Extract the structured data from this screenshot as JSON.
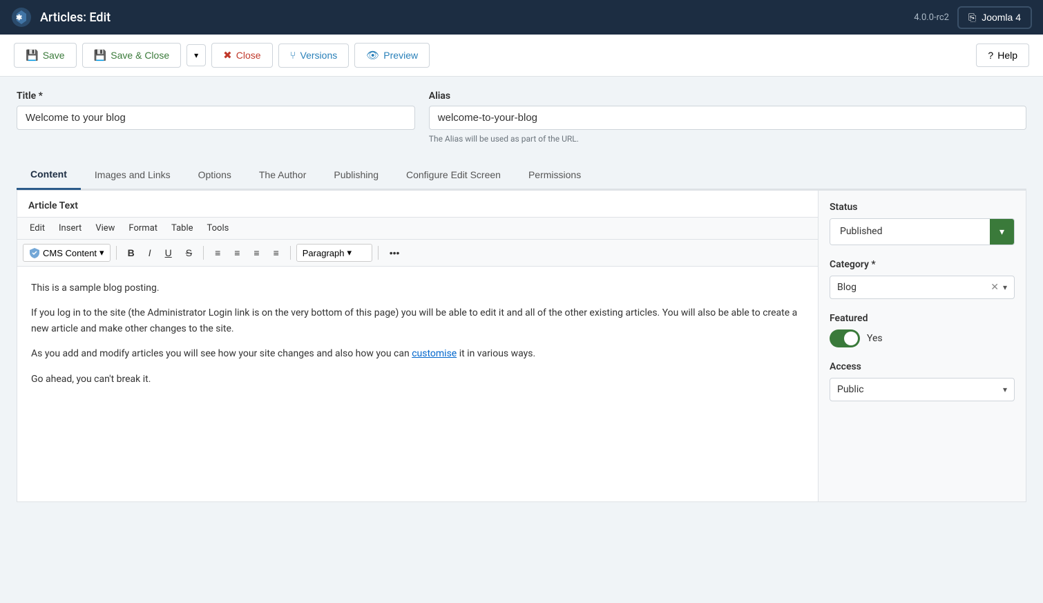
{
  "topnav": {
    "title": "Articles: Edit",
    "version": "4.0.0-rc2",
    "joomla_btn": "Joomla 4"
  },
  "toolbar": {
    "save_label": "Save",
    "save_close_label": "Save & Close",
    "close_label": "Close",
    "versions_label": "Versions",
    "preview_label": "Preview",
    "help_label": "Help"
  },
  "form": {
    "title_label": "Title *",
    "title_value": "Welcome to your blog",
    "alias_label": "Alias",
    "alias_value": "welcome-to-your-blog",
    "alias_hint": "The Alias will be used as part of the URL."
  },
  "tabs": [
    {
      "id": "content",
      "label": "Content",
      "active": true
    },
    {
      "id": "images-links",
      "label": "Images and Links",
      "active": false
    },
    {
      "id": "options",
      "label": "Options",
      "active": false
    },
    {
      "id": "the-author",
      "label": "The Author",
      "active": false
    },
    {
      "id": "publishing",
      "label": "Publishing",
      "active": false
    },
    {
      "id": "configure-edit-screen",
      "label": "Configure Edit Screen",
      "active": false
    },
    {
      "id": "permissions",
      "label": "Permissions",
      "active": false
    }
  ],
  "editor": {
    "section_label": "Article Text",
    "menu": [
      "Edit",
      "Insert",
      "View",
      "Format",
      "Table",
      "Tools"
    ],
    "cms_content_label": "CMS Content",
    "paragraph_label": "Paragraph",
    "content": [
      "This is a sample blog posting.",
      "If you log in to the site (the Administrator Login link is on the very bottom of this page) you will be able to edit it and all of the other existing articles. You will also be able to create a new article and make other changes to the site.",
      "As you add and modify articles you will see how your site changes and also how you can customise it in various ways.",
      "Go ahead, you can't break it."
    ],
    "customise_link": "customise"
  },
  "sidebar": {
    "status_label": "Status",
    "status_value": "Published",
    "category_label": "Category *",
    "category_value": "Blog",
    "featured_label": "Featured",
    "featured_toggle": "Yes",
    "access_label": "Access",
    "access_value": "Public"
  }
}
